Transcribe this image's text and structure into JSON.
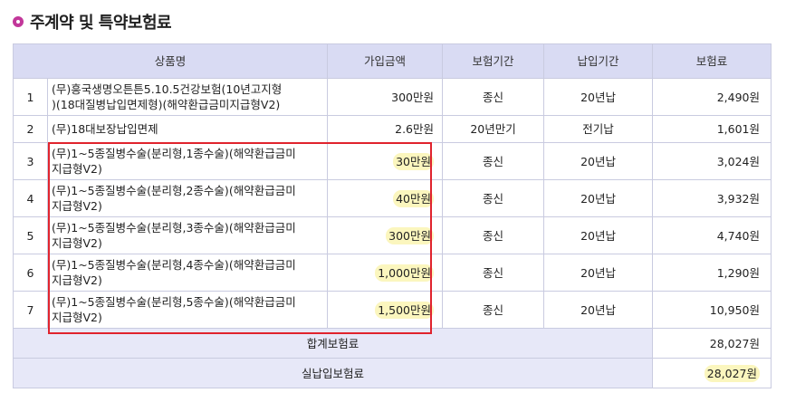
{
  "section_title": "주계약 및 특약보험료",
  "colors": {
    "accent": "#c2379a",
    "header_bg": "#d9dbf3",
    "highlight": "#fbf6be",
    "box": "#e0232d"
  },
  "table": {
    "headers": [
      "상품명",
      "가입금액",
      "보험기간",
      "납입기간",
      "보험료"
    ],
    "rows": [
      {
        "no": "1",
        "name_line1": "(무)흥국생명오튼튼5.10.5건강보험(10년고지형",
        "name_line2": ")(18대질병납입면제형)(해약환급금미지급형V2)",
        "amount": "300만원",
        "period": "종신",
        "pay_period": "20년납",
        "premium": "2,490원",
        "highlight": false
      },
      {
        "no": "2",
        "name_line1": "(무)18대보장납입면제",
        "name_line2": "",
        "amount": "2.6만원",
        "period": "20년만기",
        "pay_period": "전기납",
        "premium": "1,601원",
        "highlight": false
      },
      {
        "no": "3",
        "name_line1": "(무)1~5종질병수술(분리형,1종수술)(해약환급금미",
        "name_line2": "지급형V2)",
        "amount": "30만원",
        "period": "종신",
        "pay_period": "20년납",
        "premium": "3,024원",
        "highlight": true
      },
      {
        "no": "4",
        "name_line1": "(무)1~5종질병수술(분리형,2종수술)(해약환급금미",
        "name_line2": "지급형V2)",
        "amount": "40만원",
        "period": "종신",
        "pay_period": "20년납",
        "premium": "3,932원",
        "highlight": true
      },
      {
        "no": "5",
        "name_line1": "(무)1~5종질병수술(분리형,3종수술)(해약환급금미",
        "name_line2": "지급형V2)",
        "amount": "300만원",
        "period": "종신",
        "pay_period": "20년납",
        "premium": "4,740원",
        "highlight": true
      },
      {
        "no": "6",
        "name_line1": "(무)1~5종질병수술(분리형,4종수술)(해약환급금미",
        "name_line2": "지급형V2)",
        "amount": "1,000만원",
        "period": "종신",
        "pay_period": "20년납",
        "premium": "1,290원",
        "highlight": true
      },
      {
        "no": "7",
        "name_line1": "(무)1~5종질병수술(분리형,5종수술)(해약환급금미",
        "name_line2": "지급형V2)",
        "amount": "1,500만원",
        "period": "종신",
        "pay_period": "20년납",
        "premium": "10,950원",
        "highlight": true
      }
    ],
    "total_label": "합계보험료",
    "total_value": "28,027원",
    "actual_label": "실납입보험료",
    "actual_value": "28,027원"
  }
}
